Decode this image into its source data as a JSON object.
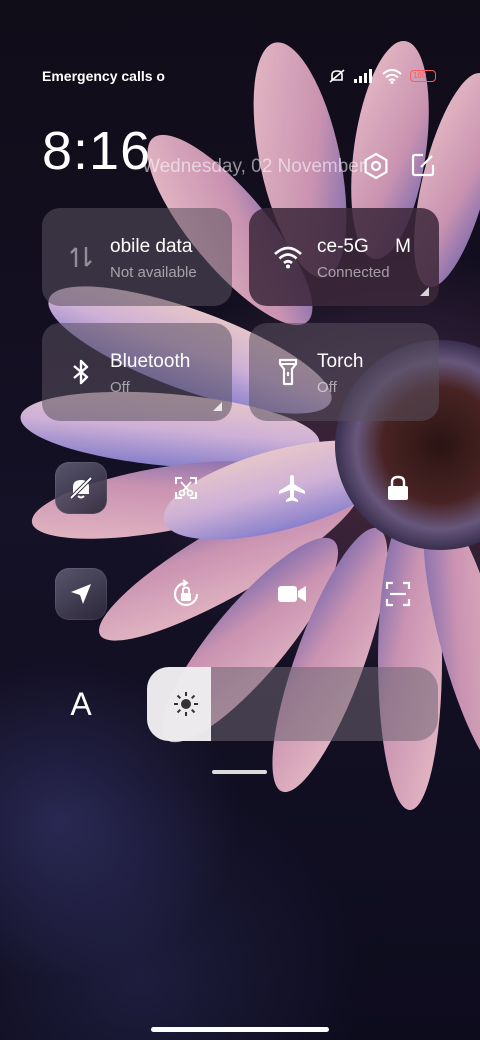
{
  "status_bar": {
    "carrier_text": "Emergency calls o",
    "battery": "100",
    "icons": [
      "silent-icon",
      "signal-icon",
      "wifi-icon",
      "battery-icon"
    ]
  },
  "header": {
    "time": "8:16",
    "date": "Wednesday, 02 November",
    "settings_icon": "settings-icon",
    "edit_icon": "edit-icon"
  },
  "tiles": [
    {
      "title": "obile data",
      "subtitle": "Not available",
      "icon": "mobile-data-icon",
      "state": "unavailable"
    },
    {
      "title": "ce-5G     M",
      "subtitle": "Connected",
      "icon": "wifi-icon",
      "state": "on"
    },
    {
      "title": "Bluetooth",
      "subtitle": "Off",
      "icon": "bluetooth-icon",
      "state": "off"
    },
    {
      "title": "Torch",
      "subtitle": "Off",
      "icon": "torch-icon",
      "state": "off"
    }
  ],
  "quick_toggles": [
    {
      "icon": "silent-bell-icon",
      "active": true
    },
    {
      "icon": "screenshot-icon",
      "active": false
    },
    {
      "icon": "airplane-icon",
      "active": false
    },
    {
      "icon": "lock-icon",
      "active": false
    },
    {
      "icon": "location-icon",
      "active": true
    },
    {
      "icon": "auto-rotate-icon",
      "active": false
    },
    {
      "icon": "video-icon",
      "active": false
    },
    {
      "icon": "scanner-icon",
      "active": false
    }
  ],
  "font_button": {
    "label": "A"
  },
  "brightness": {
    "level_fraction": 0.22,
    "icon": "sun-icon"
  },
  "colors": {
    "accent_on": "#3c283a",
    "tile_dim": "#5a505f",
    "battery_warn": "#ff5a5a"
  }
}
